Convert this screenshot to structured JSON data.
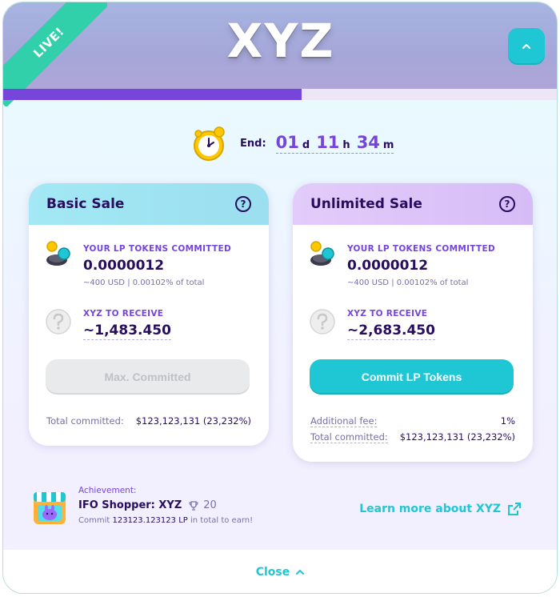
{
  "header": {
    "badge": "LIVE!",
    "title": "XYZ",
    "progress_fraction": 0.537
  },
  "timer": {
    "end_label": "End:",
    "days": "01",
    "days_unit": "d",
    "hours": "11",
    "hours_unit": "h",
    "minutes": "34",
    "minutes_unit": "m",
    "icon": "stopwatch-icon"
  },
  "basic_sale": {
    "title": "Basic Sale",
    "committed_label": "YOUR LP TOKENS COMMITTED",
    "committed_value": "0.0000012",
    "committed_sub": "~400 USD | 0.00102% of total",
    "receive_label": "XYZ TO RECEIVE",
    "receive_value": "~1,483.450",
    "button_label": "Max. Committed",
    "total_label": "Total committed:",
    "total_value": "$123,123,131 (23,232%)"
  },
  "unlimited_sale": {
    "title": "Unlimited Sale",
    "committed_label": "YOUR LP TOKENS COMMITTED",
    "committed_value": "0.0000012",
    "committed_sub": "~400 USD | 0.00102% of total",
    "receive_label": "XYZ TO RECEIVE",
    "receive_value": "~2,683.450",
    "button_label": "Commit LP Tokens",
    "fee_label": "Additional fee:",
    "fee_value": "1%",
    "total_label": "Total committed:",
    "total_value": "$123,123,131 (23,232%)"
  },
  "achievement": {
    "label": "Achievement:",
    "title": "IFO Shopper: XYZ",
    "points": "20",
    "desc_prefix": "Commit",
    "desc_amount": "123123.123123 LP",
    "desc_suffix": "in total to earn!",
    "link": "Learn more about XYZ"
  },
  "footer": {
    "close_label": "Close"
  },
  "colors": {
    "primary": "#1fc7d4",
    "secondary": "#7645d9",
    "text": "#280d5f",
    "success": "#31d0aa"
  }
}
